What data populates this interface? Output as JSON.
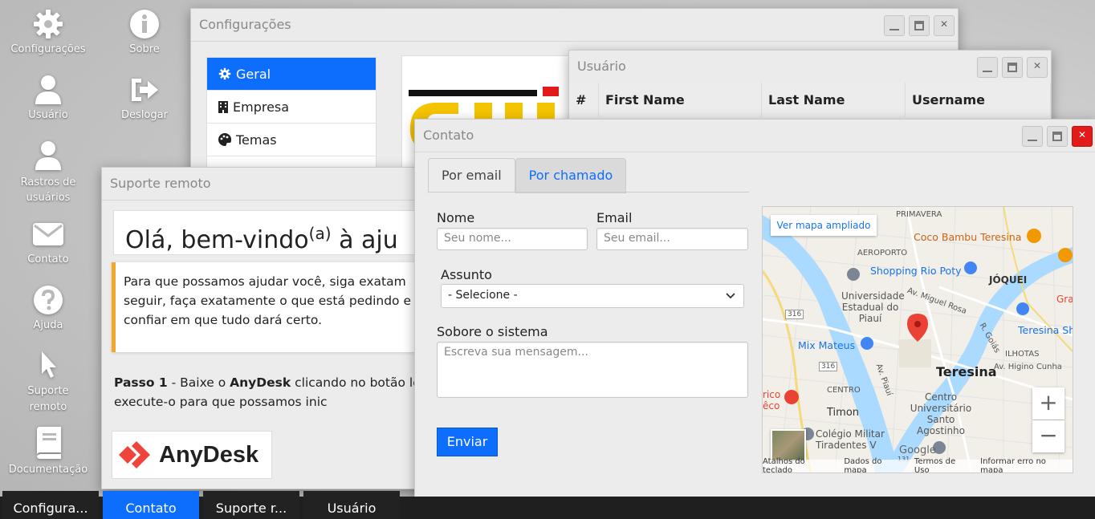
{
  "desktop": {
    "icons": [
      {
        "label": "Configurações",
        "icon": "gear-icon"
      },
      {
        "label": "Sobre",
        "icon": "info-icon"
      },
      {
        "label": "Usuário",
        "icon": "user-icon"
      },
      {
        "label": "Deslogar",
        "icon": "logout-icon"
      },
      {
        "label": "Rastros de usuários",
        "icon": "user-icon"
      },
      {
        "label": "Contato",
        "icon": "envelope-icon"
      },
      {
        "label": "Ajuda",
        "icon": "question-icon"
      },
      {
        "label": "Suporte remoto",
        "icon": "cursor-icon"
      },
      {
        "label": "Documentação",
        "icon": "book-icon"
      }
    ]
  },
  "config_window": {
    "title": "Configurações",
    "menu": [
      {
        "label": "Geral",
        "icon": "gear-icon"
      },
      {
        "label": "Empresa",
        "icon": "building-icon"
      },
      {
        "label": "Temas",
        "icon": "palette-icon"
      }
    ]
  },
  "user_window": {
    "title": "Usuário",
    "columns": [
      "#",
      "First Name",
      "Last Name",
      "Username"
    ]
  },
  "support_window": {
    "title": "Suporte remoto",
    "heading_pre": "Olá, bem-vindo",
    "heading_sup": "(a)",
    "heading_post": " à aju",
    "notice": "Para que possamos ajudar você, siga exatam seguir, faça exatamente o que está pedindo e confiar em que tudo dará certo.",
    "step_label": "Passo 1",
    "step_text_1": " - Baixe o ",
    "step_bold": "AnyDesk",
    "step_text_2": " clicando no botão logomarca e execute-o para que possamos inic",
    "anydesk_label": "AnyDesk",
    "anydesk_color": "#ef443b"
  },
  "contact_window": {
    "title": "Contato",
    "tabs": [
      "Por email",
      "Por chamado"
    ],
    "name_label": "Nome",
    "name_placeholder": "Seu nome...",
    "email_label": "Email",
    "email_placeholder": "Seu email...",
    "subject_label": "Assunto",
    "subject_value": "- Selecione -",
    "about_label": "Sobore o sistema",
    "message_placeholder": "Escreva sua mensagem...",
    "submit_label": "Enviar",
    "map": {
      "enlarge_label": "Ver mapa ampliado",
      "labels": [
        "PRIMAVERA",
        "Coco Bambu Teresina",
        "AEROPORTO",
        "Shopping Rio Poty",
        "JÓQUEI",
        "Gra",
        "Universidade Estadual do Piauí",
        "Av. Miguel Rosa",
        "R. Goiás",
        "Teresina Sho",
        "Mix Mateus",
        "ILHOTAS",
        "Av. Higino Cunha",
        "Teresina",
        "Av. Piauí",
        "CENTRO",
        "rico",
        "êco",
        "Timon",
        "Centro Universitário Santo Agostinho",
        "Colégio Militar Tiradentes V",
        "316",
        "316",
        "131",
        "Google"
      ],
      "footer": [
        "Atalhos do teclado",
        "Dados do mapa",
        "Termos de Uso",
        "Informar erro no mapa"
      ],
      "zoom_in": "+",
      "zoom_out": "−"
    }
  },
  "taskbar": [
    "Configura...",
    "Contato",
    "Suporte r...",
    "Usuário"
  ],
  "colors": {
    "accent": "#0d6efd",
    "close_red": "#e21a1a",
    "notice_border": "#f0a72c",
    "pin_red": "#ea4335"
  }
}
